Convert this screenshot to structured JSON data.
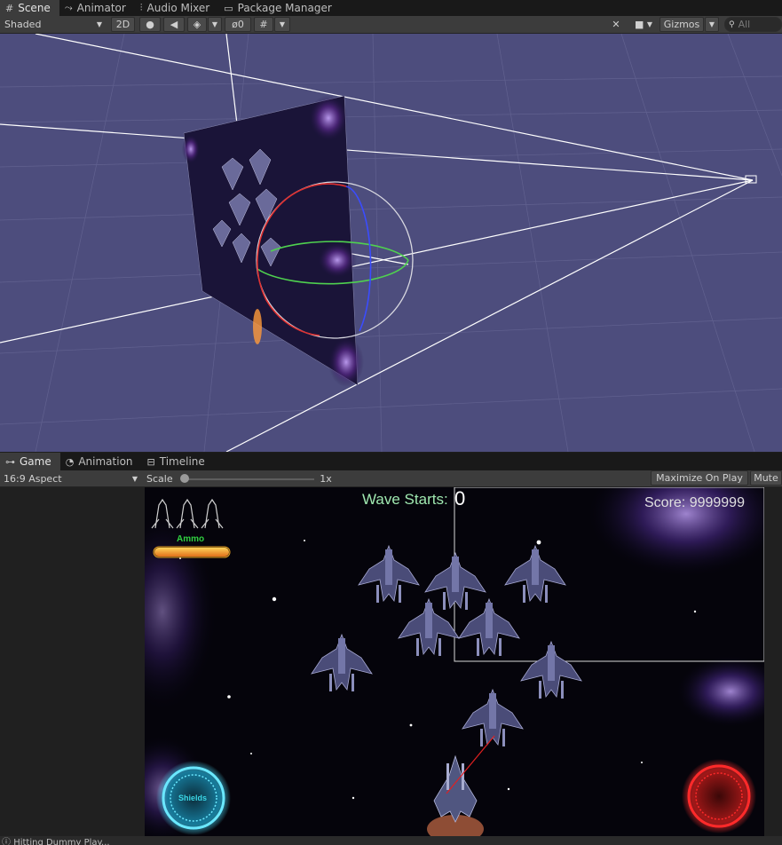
{
  "scene_tabs": [
    {
      "icon": "hash-icon",
      "label": "Scene",
      "active": true
    },
    {
      "icon": "animator-icon",
      "label": "Animator",
      "active": false
    },
    {
      "icon": "mixer-icon",
      "label": "Audio Mixer",
      "active": false
    },
    {
      "icon": "package-icon",
      "label": "Package Manager",
      "active": false
    }
  ],
  "scene_toolbar": {
    "draw_mode": "Shaded",
    "mode_2d": "2D",
    "hidden_count": "0",
    "gizmos": "Gizmos",
    "search_placeholder": "All"
  },
  "game_tabs": [
    {
      "icon": "gamepad-icon",
      "label": "Game",
      "active": true
    },
    {
      "icon": "animation-clock-icon",
      "label": "Animation",
      "active": false
    },
    {
      "icon": "timeline-icon",
      "label": "Timeline",
      "active": false
    }
  ],
  "game_toolbar": {
    "aspect": "16:9 Aspect",
    "scale_label": "Scale",
    "scale_value": "1x",
    "maximize": "Maximize On Play",
    "mute": "Mute"
  },
  "hud": {
    "wave_label": "Wave Starts:",
    "wave_value": "0",
    "score": "Score: 9999999",
    "ammo_label": "Ammo",
    "shields_label": "Shields",
    "ammo_fill": 1.0,
    "lives": 3
  },
  "status_text": "Hitting Dummy Play..."
}
